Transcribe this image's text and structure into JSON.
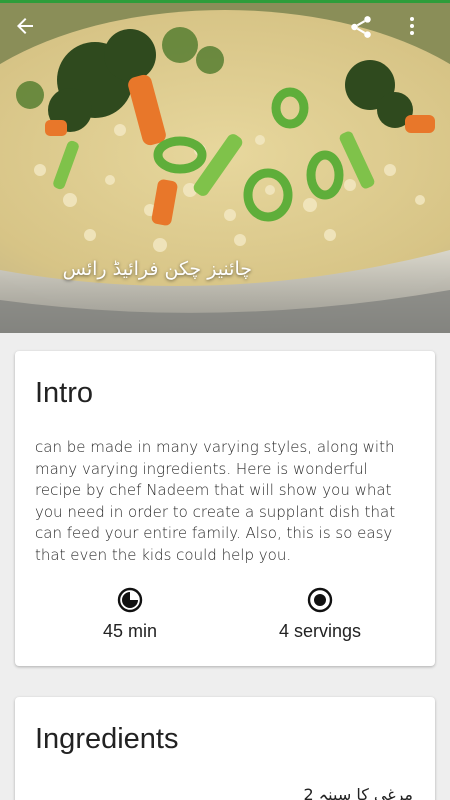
{
  "colors": {
    "status_accent": "#2e9d3a",
    "card_bg": "#ffffff",
    "page_bg": "#eeeeee"
  },
  "header": {
    "back_icon": "arrow-left-icon",
    "share_icon": "share-icon",
    "more_icon": "more-vert-icon"
  },
  "hero": {
    "title": "چائنیز چکن فرائیڈ رائس",
    "image": "fried-rice-photo"
  },
  "intro": {
    "heading": "Intro",
    "lines": [
      "can be made in many varying styles, along with",
      "many varying ingredients. Here is wonderful",
      "recipe by chef Nadeem that will show you what",
      "you need in order to create a supplant dish that",
      "can feed your entire family. Also, this is so easy",
      "that even the kids could help you."
    ],
    "time_icon": "timer-icon",
    "time": "45 min",
    "servings_icon": "servings-icon",
    "servings": "4 servings"
  },
  "ingredients": {
    "heading": "Ingredients",
    "items": [
      "مرغی کا سینہ 2"
    ]
  }
}
